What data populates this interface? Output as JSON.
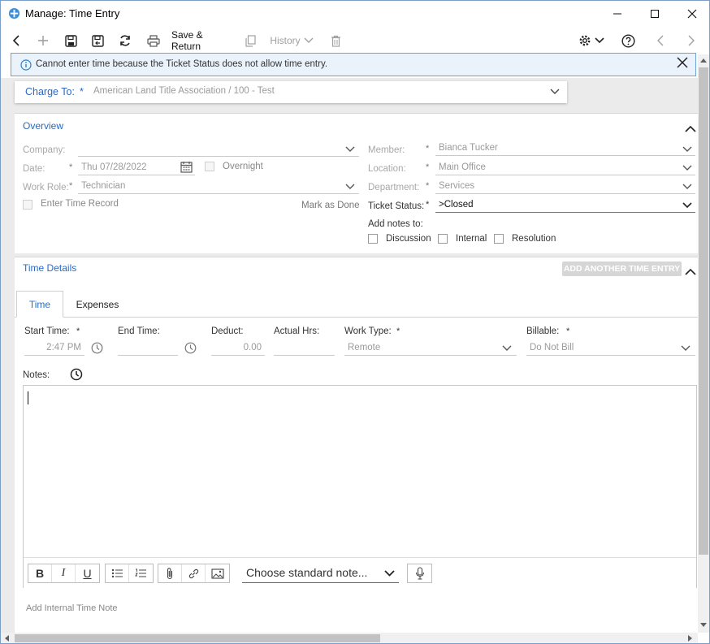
{
  "window": {
    "title": "Manage: Time Entry"
  },
  "toolbar": {
    "save_return_label": "Save & Return",
    "history_label": "History"
  },
  "banner": {
    "message": "Cannot enter time because the Ticket Status does not allow time entry."
  },
  "charge": {
    "label": "Charge To:",
    "required_mark": "*",
    "value": "American Land Title Association / 100 - Test"
  },
  "overview": {
    "title": "Overview",
    "company_label": "Company:",
    "company_value": "",
    "date_label": "Date:",
    "date_value": "Thu 07/28/2022",
    "overnight_label": "Overnight",
    "work_role_label": "Work Role:",
    "work_role_value": "Technician",
    "enter_time_record_label": "Enter Time Record",
    "mark_as_done_label": "Mark as Done",
    "member_label": "Member:",
    "member_value": "Bianca Tucker",
    "location_label": "Location:",
    "location_value": "Main Office",
    "department_label": "Department:",
    "department_value": "Services",
    "ticket_status_label": "Ticket Status:",
    "ticket_status_value": ">Closed",
    "add_notes_label": "Add notes to:",
    "discussion_label": "Discussion",
    "internal_label": "Internal",
    "resolution_label": "Resolution"
  },
  "time_details": {
    "title": "Time Details",
    "add_button": "ADD ANOTHER TIME ENTRY",
    "tabs": [
      {
        "label": "Time"
      },
      {
        "label": "Expenses"
      }
    ],
    "start_time_label": "Start Time:",
    "start_time_value": "2:47 PM",
    "end_time_label": "End Time:",
    "end_time_value": "",
    "deduct_label": "Deduct:",
    "deduct_value": "0.00",
    "actual_hrs_label": "Actual Hrs:",
    "actual_hrs_value": "",
    "work_type_label": "Work Type:",
    "work_type_value": "Remote",
    "billable_label": "Billable:",
    "billable_value": "Do Not Bill",
    "notes_label": "Notes:",
    "standard_note_placeholder": "Choose standard note...",
    "add_internal_note_label": "Add Internal Time Note"
  },
  "colors": {
    "accent": "#2a6bbf",
    "banner_bg": "#eaf3fb",
    "banner_border": "#6aa3d8"
  }
}
